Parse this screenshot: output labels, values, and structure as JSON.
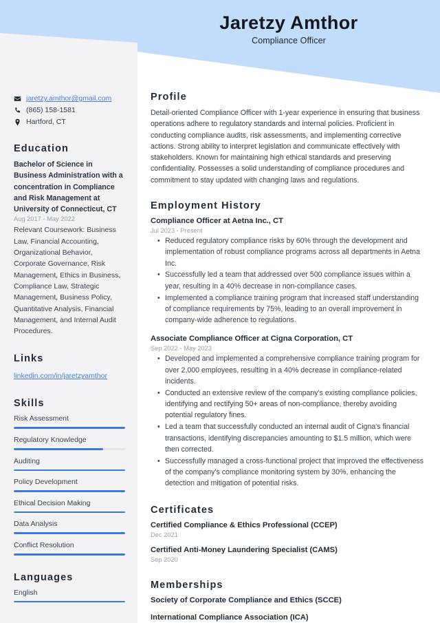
{
  "header": {
    "name": "Jaretzy Amthor",
    "job_title": "Compliance Officer",
    "banner_color": "#c2dcfb"
  },
  "sidebar": {
    "contact": {
      "email": "jaretzy.amthor@gmail.com",
      "email_icon": "envelope-icon",
      "phone": "(865) 158-1581",
      "phone_icon": "phone-icon",
      "location": "Hartford, CT",
      "location_icon": "map-pin-icon"
    },
    "education": {
      "heading": "Education",
      "degree": "Bachelor of Science in Business Administration with a concentration in Compliance and Risk Management at University of Connecticut, CT",
      "date": "Aug 2017 - May 2022",
      "description": "Relevant Coursework: Business Law, Financial Accounting, Organizational Behavior, Corporate Governance, Risk Management, Ethics in Business, Compliance Law, Strategic Management, Business Policy, Quantitative Analysis, Financial Management, and Internal Audit Procedures."
    },
    "links": {
      "heading": "Links",
      "items": [
        {
          "label": "linkedin.com/in/jaretzyamthor"
        }
      ]
    },
    "skills": {
      "heading": "Skills",
      "bar_color": "#3b7ae4",
      "track_color": "#e3e4e8",
      "items": [
        {
          "label": "Risk Assessment",
          "level": 100
        },
        {
          "label": "Regulatory Knowledge",
          "level": 80
        },
        {
          "label": "Auditing",
          "level": 100
        },
        {
          "label": "Policy Development",
          "level": 100
        },
        {
          "label": "Ethical Decision Making",
          "level": 100
        },
        {
          "label": "Data Analysis",
          "level": 100
        },
        {
          "label": "Conflict Resolution",
          "level": 100
        }
      ]
    },
    "languages": {
      "heading": "Languages",
      "items": [
        {
          "label": "English",
          "level": 100
        }
      ]
    }
  },
  "main": {
    "profile": {
      "heading": "Profile",
      "text": "Detail-oriented Compliance Officer with 1-year experience in ensuring that business operations adhere to regulatory standards and internal policies. Proficient in conducting compliance audits, risk assessments, and implementing corrective actions. Strong ability to interpret legislation and communicate effectively with stakeholders. Known for maintaining high ethical standards and preserving confidentiality. Possesses a solid understanding of compliance procedures and commitment to stay updated with changing laws and regulations."
    },
    "employment": {
      "heading": "Employment History",
      "jobs": [
        {
          "title": "Compliance Officer at Aetna Inc., CT",
          "date": "Jul 2023 - Present",
          "bullets": [
            "Reduced regulatory compliance risks by 60% through the development and implementation of robust compliance programs across all departments in Aetna Inc.",
            "Successfully led a team that addressed over 500 compliance issues within a year, resulting in a 40% decrease in non-compliance cases.",
            "Implemented a compliance training program that increased staff understanding of compliance requirements by 75%, leading to an overall improvement in company-wide adherence to regulations."
          ]
        },
        {
          "title": "Associate Compliance Officer at Cigna Corporation, CT",
          "date": "Sep 2022 - May 2023",
          "bullets": [
            "Developed and implemented a comprehensive compliance training program for over 2,000 employees, resulting in a 40% decrease in compliance-related incidents.",
            "Conducted an extensive review of the company's existing compliance policies, identifying and rectifying 50+ areas of non-compliance, thereby avoiding potential regulatory fines.",
            "Led a team that successfully conducted an internal audit of Cigna's financial transactions, identifying discrepancies amounting to $1.5 million, which were then corrected.",
            "Successfully managed a cross-functional project that improved the effectiveness of the company's compliance monitoring system by 30%, enhancing the detection and mitigation of potential risks."
          ]
        }
      ]
    },
    "certificates": {
      "heading": "Certificates",
      "items": [
        {
          "name": "Certified Compliance & Ethics Professional (CCEP)",
          "date": "Dec 2021"
        },
        {
          "name": "Certified Anti-Money Laundering Specialist (CAMS)",
          "date": "Sep 2020"
        }
      ]
    },
    "memberships": {
      "heading": "Memberships",
      "items": [
        {
          "name": "Society of Corporate Compliance and Ethics (SCCE)"
        },
        {
          "name": "International Compliance Association (ICA)"
        }
      ]
    }
  }
}
